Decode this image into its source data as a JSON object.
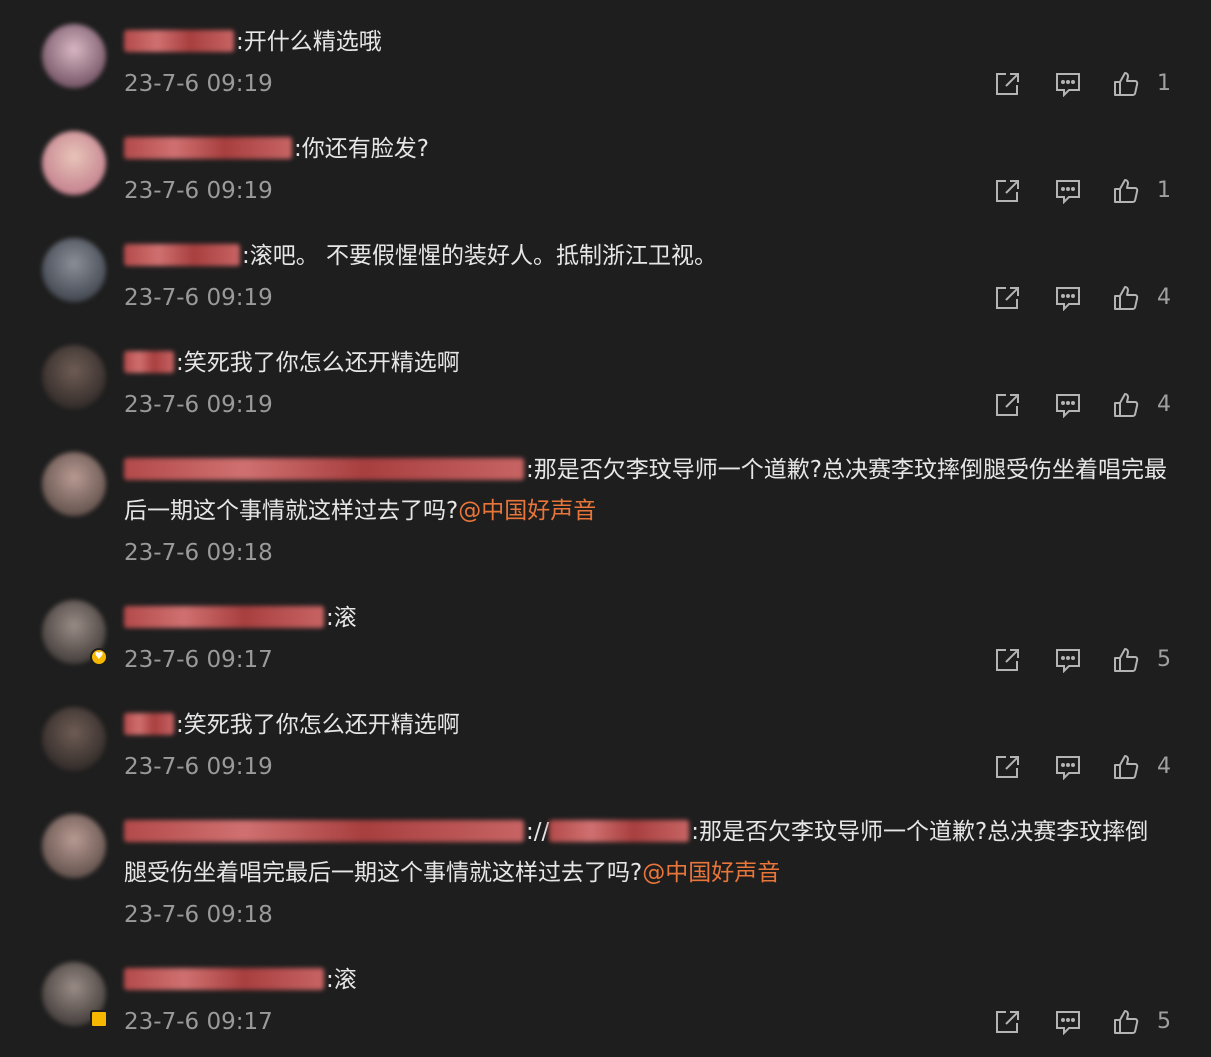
{
  "comments": [
    {
      "username": "一直楼下_",
      "text": ":开什么精选哦",
      "time": "23-7-6 09:19",
      "likes": "1",
      "avatar_colors": [
        "#d8b7c2",
        "#6a4a5c"
      ]
    },
    {
      "username": "@@@@@@@@@@@@@@",
      "text": ":你还有脸发?",
      "time": "23-7-6 09:19",
      "likes": "1",
      "avatar_colors": [
        "#e8c4b8",
        "#c07a8a"
      ]
    },
    {
      "username": "@@@@@@@@@@",
      "text": ":滚吧。 不要假惺惺的装好人。抵制浙江卫视。",
      "time": "23-7-6 09:19",
      "likes": "4",
      "avatar_colors": [
        "#8a8f98",
        "#3a3f48"
      ]
    },
    {
      "username": "@@@@@",
      "text": ":笑死我了你怎么还开精选啊",
      "time": "23-7-6 09:19",
      "likes": "4",
      "avatar_colors": [
        "#6f5c55",
        "#2b2624"
      ]
    },
    {
      "username": "@@@@@@@@@@@@@@@@@@@@@@@@@@@@@@@@@@",
      "text": ":那是否欠李玟导师一个道歉?总决赛李玟摔倒腿受伤坐着唱完最后一期这个事情就这样过去了吗?",
      "mention": "@中国好声音",
      "time": "23-7-6 09:18",
      "likes": "",
      "avatar_colors": [
        "#b89a92",
        "#5a4a45"
      ]
    },
    {
      "username": "@@@@@@@@@@@@@@@@@@@@@",
      "text": ":滚",
      "time": "23-7-6 09:17",
      "likes": "5",
      "avatar_colors": [
        "#9a8c86",
        "#3a3533"
      ],
      "badge": "round"
    },
    {
      "username": "@@@@@",
      "text": ":笑死我了你怎么还开精选啊",
      "time": "23-7-6 09:19",
      "likes": "4",
      "avatar_colors": [
        "#6f5c55",
        "#2b2624"
      ]
    },
    {
      "username": "@@@@@@@@@@@@@@@@@@@@@@",
      "text": "://@@@@@@@@@@@@@:那是否欠李玟导师一个道歉?总决赛李玟摔倒腿受伤坐着唱完最后一期这个事情就这样过去了吗?",
      "mention": "@中国好声音",
      "time": "23-7-6 09:18",
      "likes": "",
      "avatar_colors": [
        "#b89a92",
        "#5a4a45"
      ]
    },
    {
      "username": "@@@@@@@@@@@@@@@@@@@@@",
      "text": ":滚",
      "time": "23-7-6 09:17",
      "likes": "5",
      "avatar_colors": [
        "#9a8c86",
        "#3a3533"
      ],
      "badge": "square"
    }
  ],
  "icons": {
    "share": "share-icon",
    "reply": "comment-icon",
    "like": "thumbs-up-icon"
  },
  "colors": {
    "background": "#1e1e1e",
    "text": "#e6e6e6",
    "meta": "#9a9a9a",
    "mention": "#e8753a",
    "username_blur": "#c25858"
  }
}
